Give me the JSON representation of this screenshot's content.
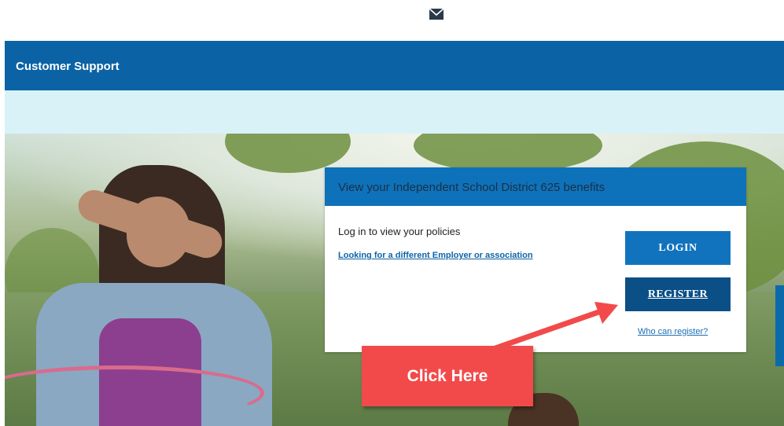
{
  "top": {
    "icon": "mail-icon"
  },
  "header": {
    "title": "Customer Support"
  },
  "card": {
    "title": "View your Independent School District 625 benefits",
    "intro": "Log in to view your policies",
    "employer_link": "Looking for a different Employer or association",
    "login_label": "LOGIN",
    "register_label": "REGISTER",
    "who_link": "Who can register?"
  },
  "annotation": {
    "callout_text": "Click Here"
  },
  "colors": {
    "header": "#0b63a5",
    "subbar": "#d8f2f8",
    "card_header": "#0e72ba",
    "login": "#1173bd",
    "register": "#0a4f86",
    "callout": "#f24a4a"
  }
}
